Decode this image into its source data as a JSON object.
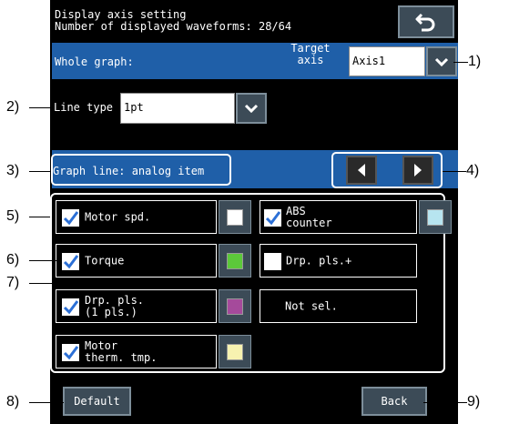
{
  "header": {
    "title": "Display axis setting",
    "waveforms_label": "Number of displayed waveforms: 28/64"
  },
  "whole_graph": {
    "label": "Whole graph:",
    "target_axis_line1": "Target",
    "target_axis_line2": "axis",
    "axis_value": "Axis1"
  },
  "line_type": {
    "label": "Line type",
    "value": "1pt"
  },
  "graph_line": {
    "label": "Graph line: analog item"
  },
  "items": [
    {
      "line1": "Motor spd.",
      "line2": "",
      "checked": true,
      "color": "#ffffff"
    },
    {
      "line1": "ABS",
      "line2": "counter",
      "checked": true,
      "color": "#b7e5f0"
    },
    {
      "line1": "Torque",
      "line2": "",
      "checked": true,
      "color": "#5cc83a"
    },
    {
      "line1": "Drp. pls.+",
      "line2": "",
      "checked": false,
      "color": null
    },
    {
      "line1": "Drp. pls.",
      "line2": "(1 pls.)",
      "checked": true,
      "color": "#a54a9b"
    },
    {
      "line1": "Not sel.",
      "line2": "",
      "checked": false,
      "color": null
    },
    {
      "line1": "Motor",
      "line2": "therm. tmp.",
      "checked": true,
      "color": "#f7f2b0"
    }
  ],
  "buttons": {
    "default_label": "Default",
    "back_label": "Back"
  },
  "callouts": [
    "1)",
    "2)",
    "3)",
    "4)",
    "5)",
    "6)",
    "7)",
    "8)",
    "9)"
  ],
  "icons": {
    "return": "return-arrow-icon",
    "dropdown": "chevron-down-icon",
    "prev": "triangle-left-icon",
    "next": "triangle-right-icon",
    "check": "checkmark-icon"
  },
  "colors": {
    "screen_bg": "#000000",
    "bar_blue": "#1f5fa8",
    "button_gray": "#3c4b57",
    "check_blue": "#2b6fd6"
  }
}
